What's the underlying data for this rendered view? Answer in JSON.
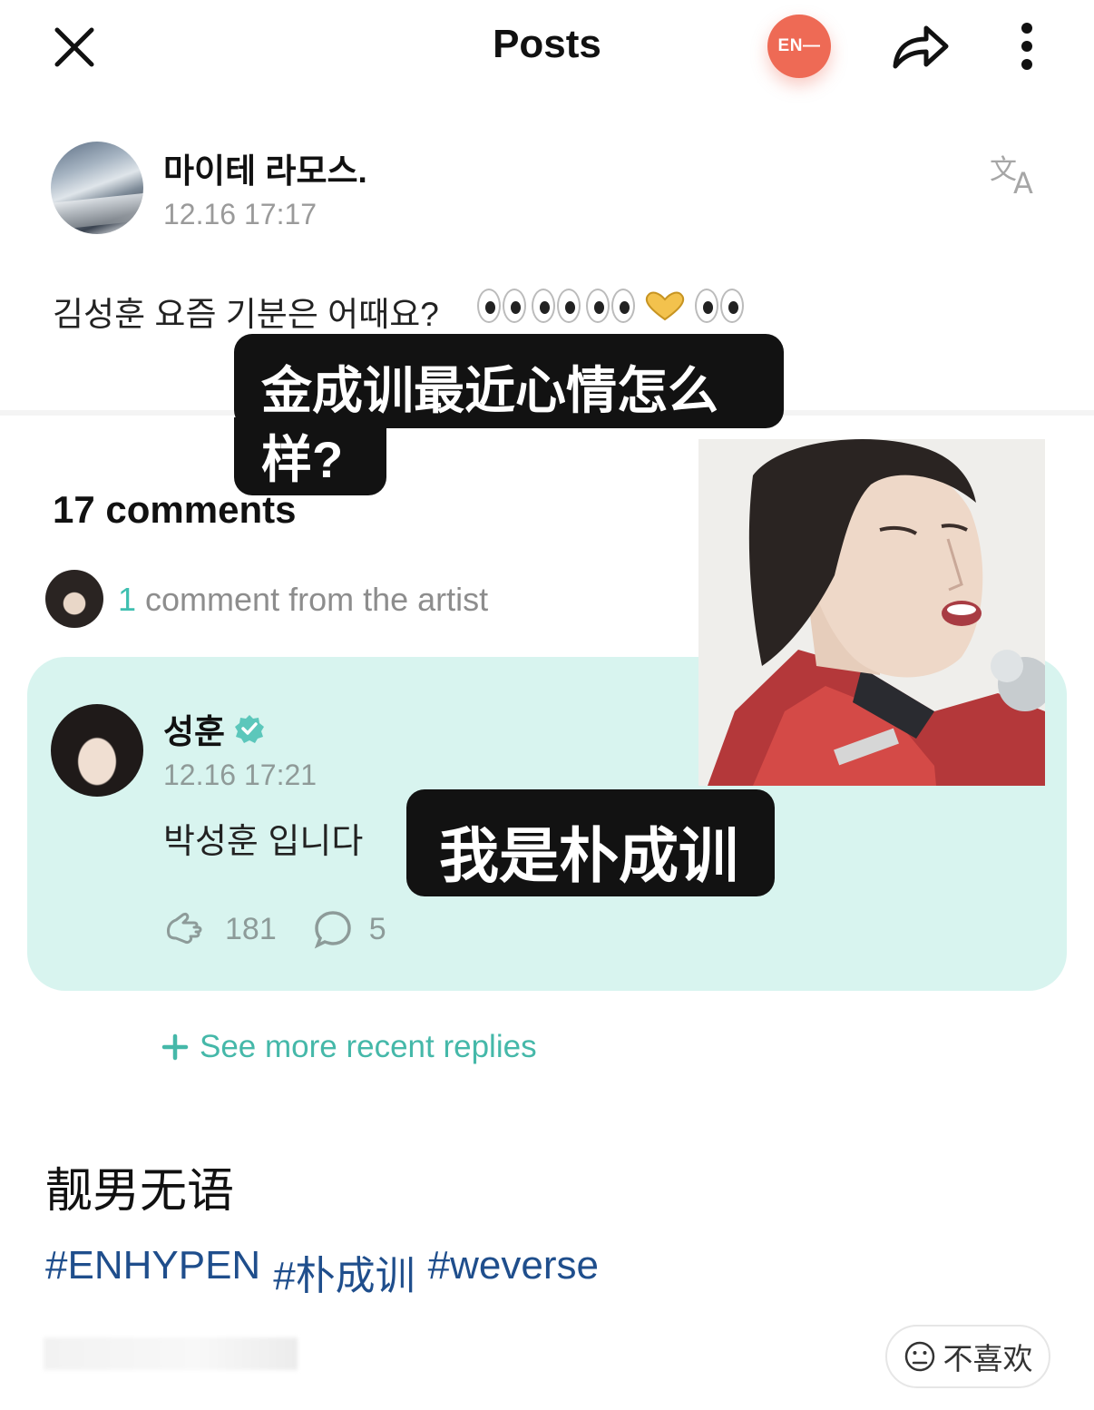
{
  "header": {
    "title": "Posts",
    "brand_badge": "EN—",
    "close_icon": "close-icon",
    "share_icon": "share-icon",
    "more_icon": "more-vertical-icon"
  },
  "post": {
    "author": "마이테 라모스.",
    "time": "12.16 17:17",
    "text": "김성훈 요즘 기분은 어때요?",
    "translate_icon": "translate-icon"
  },
  "captions": {
    "question_line1": "金成训最近心情怎么",
    "question_line2": "样?",
    "answer": "我是朴成训"
  },
  "comments": {
    "count_label": "17 comments",
    "artist_count_num": "1",
    "artist_count_label": " comment from the artist",
    "artist_comment": {
      "name": "성훈",
      "time": "12.16 17:21",
      "text": "박성훈 입니다",
      "likes": "181",
      "replies": "5"
    },
    "see_more": "See more recent replies"
  },
  "weibo": {
    "text": "靓男无语",
    "hashtags": [
      "#ENHYPEN",
      "#朴成训",
      "#weverse"
    ],
    "dislike_label": "不喜欢"
  },
  "colors": {
    "accent_teal": "#45b8a9",
    "card_bg": "#d8f4ef",
    "brand_orange": "#ee6a55",
    "hashtag_blue": "#1f4e8c"
  }
}
